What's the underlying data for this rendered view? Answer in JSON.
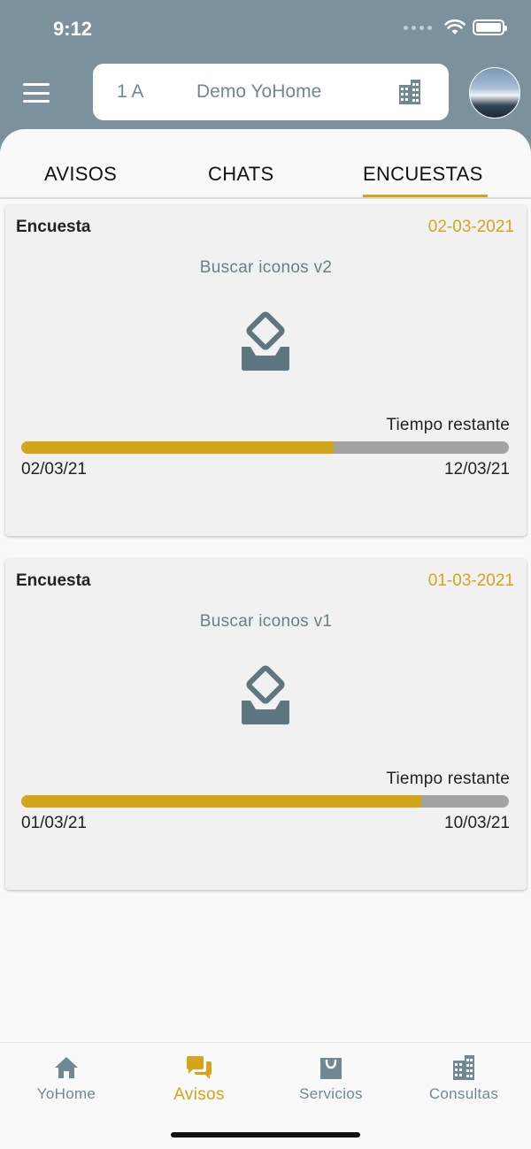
{
  "status_bar": {
    "time": "9:12"
  },
  "header": {
    "unit": "1 A",
    "community_name": "Demo YoHome"
  },
  "tabs": [
    {
      "label": "AVISOS",
      "active": false
    },
    {
      "label": "CHATS",
      "active": false
    },
    {
      "label": "ENCUESTAS",
      "active": true
    }
  ],
  "surveys": [
    {
      "type": "Encuesta",
      "date": "02-03-2021",
      "title": "Buscar iconos v2",
      "remaining_label": "Tiempo restante",
      "start_date": "02/03/21",
      "end_date": "12/03/21",
      "progress": 0.64
    },
    {
      "type": "Encuesta",
      "date": "01-03-2021",
      "title": "Buscar iconos v1",
      "remaining_label": "Tiempo restante",
      "start_date": "01/03/21",
      "end_date": "10/03/21",
      "progress": 0.82
    }
  ],
  "bottom_nav": [
    {
      "label": "YoHome",
      "icon": "home-icon",
      "active": false
    },
    {
      "label": "Avisos",
      "icon": "chat-bubbles-icon",
      "active": true
    },
    {
      "label": "Servicios",
      "icon": "shopping-bag-icon",
      "active": false
    },
    {
      "label": "Consultas",
      "icon": "building-icon",
      "active": false
    }
  ],
  "colors": {
    "accent": "#d4a51a",
    "header_bg": "#7b929c",
    "muted": "#6f8892",
    "progress_track": "#a3a3a3"
  }
}
